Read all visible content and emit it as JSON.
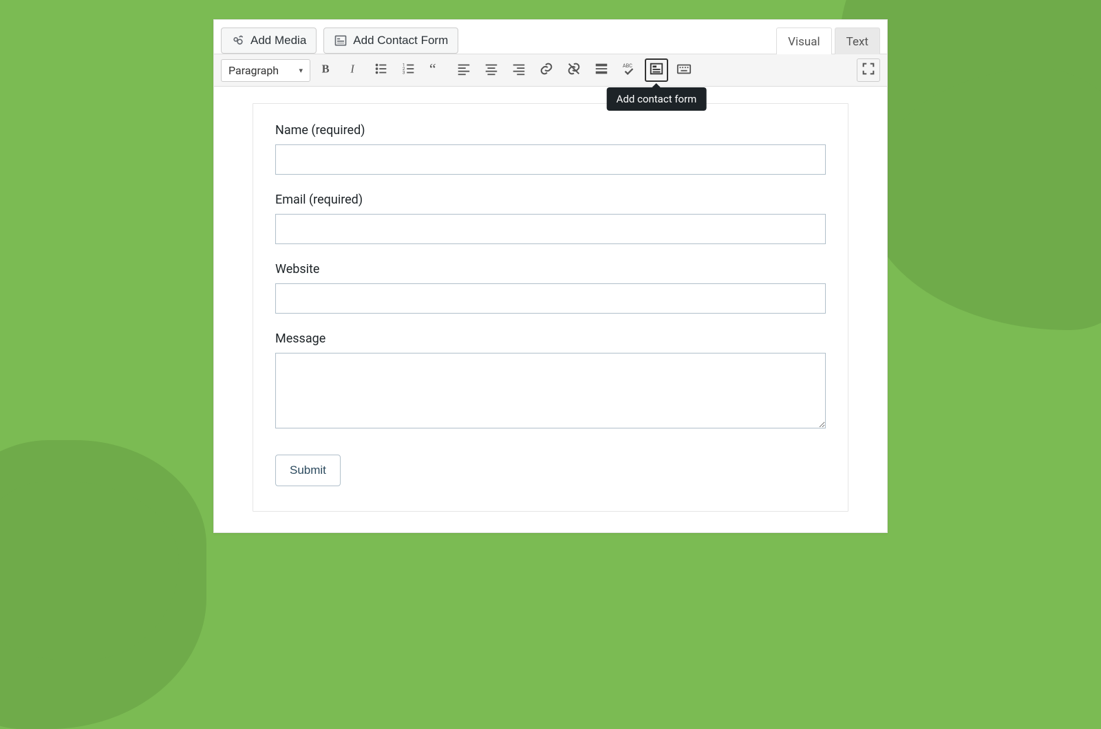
{
  "toolbar": {
    "add_media_label": "Add Media",
    "add_contact_form_label": "Add Contact Form"
  },
  "tabs": {
    "visual": "Visual",
    "text": "Text"
  },
  "format_bar": {
    "paragraph_label": "Paragraph",
    "tooltip_add_contact_form": "Add contact form"
  },
  "form": {
    "fields": {
      "name": {
        "label": "Name (required)",
        "value": ""
      },
      "email": {
        "label": "Email (required)",
        "value": ""
      },
      "website": {
        "label": "Website",
        "value": ""
      },
      "message": {
        "label": "Message",
        "value": ""
      }
    },
    "submit_label": "Submit"
  }
}
